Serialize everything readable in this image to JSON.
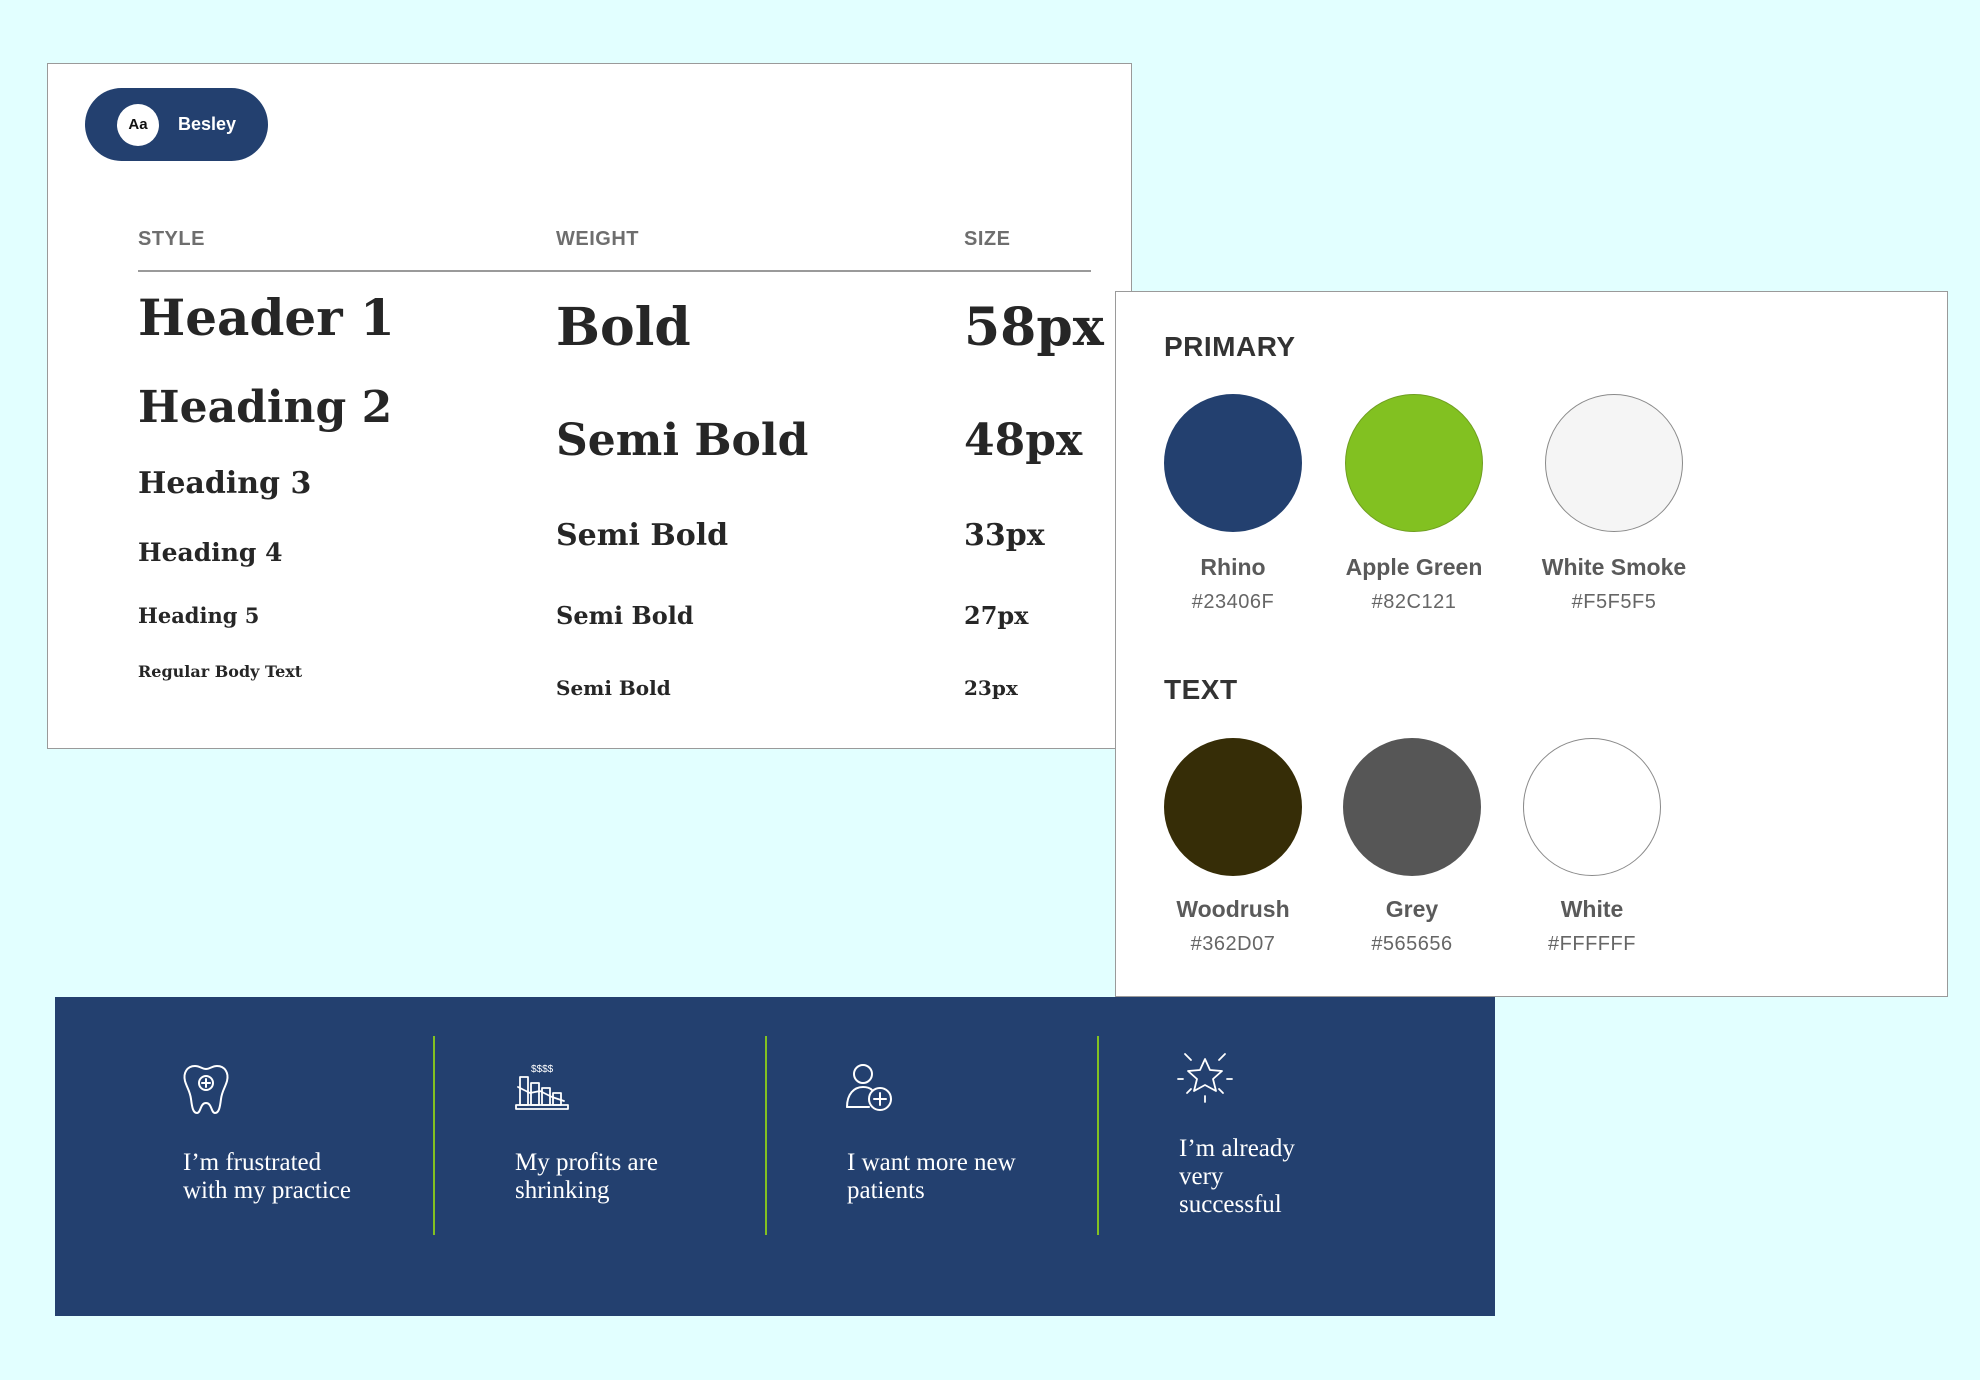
{
  "typography": {
    "font_badge": "Aa",
    "font_name": "Besley",
    "columns": {
      "style": "STYLE",
      "weight": "WEIGHT",
      "size": "SIZE"
    },
    "rows": [
      {
        "style": "Header 1",
        "weight": "Bold",
        "size": "58px"
      },
      {
        "style": "Heading 2",
        "weight": "Semi Bold",
        "size": "48px"
      },
      {
        "style": "Heading 3",
        "weight": "Semi Bold",
        "size": "33px"
      },
      {
        "style": "Heading 4",
        "weight": "Semi Bold",
        "size": "27px"
      },
      {
        "style": "Heading 5",
        "weight": "Semi Bold",
        "size": "23px"
      },
      {
        "style": "Regular Body Text"
      }
    ]
  },
  "colors": {
    "primary_title": "PRIMARY",
    "text_title": "TEXT",
    "primary": [
      {
        "name": "Rhino",
        "hex": "#23406F"
      },
      {
        "name": "Apple Green",
        "hex": "#82C121"
      },
      {
        "name": "White Smoke",
        "hex": "#F5F5F5"
      }
    ],
    "text": [
      {
        "name": "Woodrush",
        "hex": "#362D07"
      },
      {
        "name": "Grey",
        "hex": "#565656"
      },
      {
        "name": "White",
        "hex": "#FFFFFF"
      }
    ]
  },
  "problems": [
    {
      "icon": "tooth-icon",
      "text_lines": [
        "I’m frustrated",
        "with my practice"
      ]
    },
    {
      "icon": "shrinking-profits-chart-icon",
      "text_lines": [
        "My profits are",
        "shrinking"
      ]
    },
    {
      "icon": "add-patient-icon",
      "text_lines": [
        "I want more new",
        "patients"
      ]
    },
    {
      "icon": "sparkling-star-icon",
      "text_lines": [
        "I’m already",
        "very",
        "successful"
      ]
    }
  ],
  "theme": {
    "background": "#E2FFFF",
    "band": "#23406F",
    "accent": "#82C121"
  }
}
